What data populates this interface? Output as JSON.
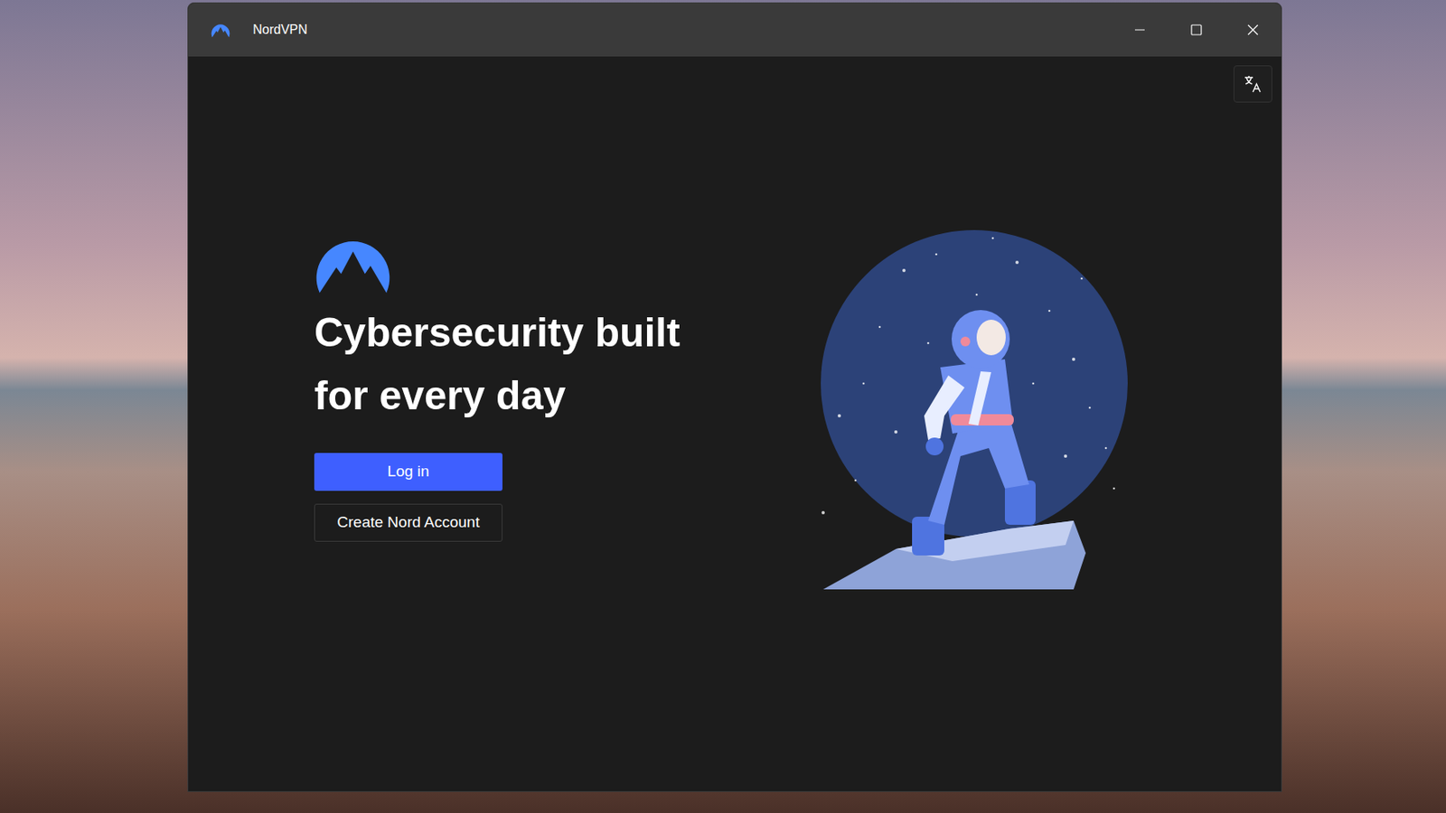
{
  "window": {
    "title": "NordVPN"
  },
  "hero": {
    "headline_lines": [
      "Cybersecurity built",
      "for every day"
    ]
  },
  "buttons": [
    {
      "label": "Log in",
      "kind": "primary"
    },
    {
      "label": "Create Nord Account",
      "kind": "secondary"
    }
  ]
}
